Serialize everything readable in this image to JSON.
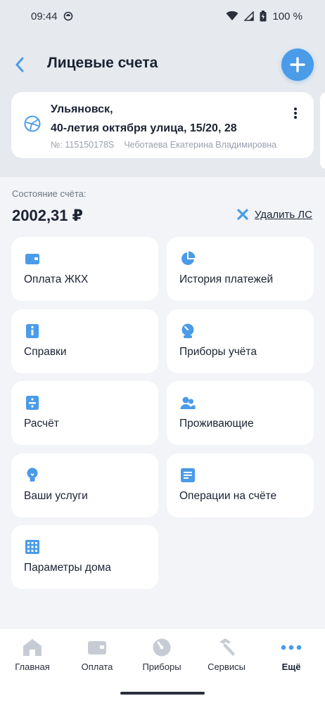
{
  "status_bar": {
    "time": "09:44",
    "battery": "100 %"
  },
  "header": {
    "title": "Лицевые счета"
  },
  "account": {
    "city": "Ульяновск,",
    "street": "40-летия октября улица, 15/20, 28",
    "number": "№: 115150178S",
    "owner": "Чеботаева Екатерина Владимировна"
  },
  "balance": {
    "label": "Состояние счёта:",
    "amount": "2002,31 ₽",
    "delete_label": "Удалить ЛС"
  },
  "tiles": [
    {
      "label": "Оплата ЖКХ",
      "icon": "wallet-icon"
    },
    {
      "label": "История платежей",
      "icon": "pie-chart-icon"
    },
    {
      "label": "Справки",
      "icon": "info-icon"
    },
    {
      "label": "Приборы учёта",
      "icon": "meter-icon"
    },
    {
      "label": "Расчёт",
      "icon": "calculator-icon"
    },
    {
      "label": "Проживающие",
      "icon": "residents-icon"
    },
    {
      "label": "Ваши услуги",
      "icon": "lightbulb-icon"
    },
    {
      "label": "Операции на счёте",
      "icon": "document-icon"
    },
    {
      "label": "Параметры дома",
      "icon": "building-icon"
    }
  ],
  "nav": [
    {
      "label": "Главная",
      "icon": "home-icon"
    },
    {
      "label": "Оплата",
      "icon": "wallet-icon"
    },
    {
      "label": "Приборы",
      "icon": "meter-icon"
    },
    {
      "label": "Сервисы",
      "icon": "hammer-icon"
    },
    {
      "label": "Ещё",
      "icon": "more-icon"
    }
  ],
  "colors": {
    "accent": "#4a9be8",
    "nav_icon": "#c7ccd4",
    "background": "#f2f4f7"
  }
}
